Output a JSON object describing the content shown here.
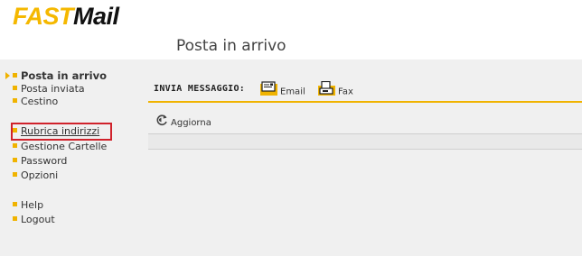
{
  "brand": {
    "part1": "FAST",
    "part2": "Mail"
  },
  "page_title": "Posta in arrivo",
  "sidebar": {
    "items": [
      {
        "label": "Posta in arrivo"
      },
      {
        "label": "Posta inviata"
      },
      {
        "label": "Cestino"
      },
      {
        "label": "Rubrica indirizzi"
      },
      {
        "label": "Gestione Cartelle"
      },
      {
        "label": "Password"
      },
      {
        "label": "Opzioni"
      },
      {
        "label": "Help"
      },
      {
        "label": "Logout"
      }
    ]
  },
  "toolbar": {
    "label": "INVIA MESSAGGIO:",
    "email_label": "Email",
    "fax_label": "Fax"
  },
  "actions": {
    "refresh_label": "Aggiorna"
  },
  "colors": {
    "accent": "#f0b300",
    "brand_yellow": "#f5b800",
    "highlight": "#d0222b"
  },
  "icons": [
    "email-icon",
    "fax-icon",
    "refresh-icon",
    "arrow-icon"
  ]
}
